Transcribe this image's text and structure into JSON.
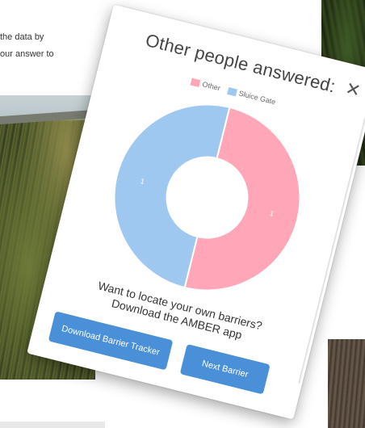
{
  "background": {
    "text_lines": [
      "the data by",
      "our answer to"
    ]
  },
  "modal": {
    "title": "Other people answered:",
    "close_icon": "close-icon",
    "legend": [
      {
        "label": "Other",
        "color": "#ffa6b8"
      },
      {
        "label": "Sluice Gate",
        "color": "#9ec8f0"
      }
    ],
    "prompt_line1": "Want to locate your own barriers?",
    "prompt_line2": "Download the AMBER app",
    "download_button_label": "Download Barrier Tracker",
    "next_button_label": "Next Barrier",
    "button_color": "#4a90d9"
  },
  "chart_data": {
    "type": "pie",
    "categories": [
      "Other",
      "Sluice Gate"
    ],
    "values": [
      1,
      1
    ],
    "data_labels": [
      "1",
      "1"
    ],
    "colors": [
      "#ffa6b8",
      "#9ec8f0"
    ],
    "doughnut": true
  }
}
